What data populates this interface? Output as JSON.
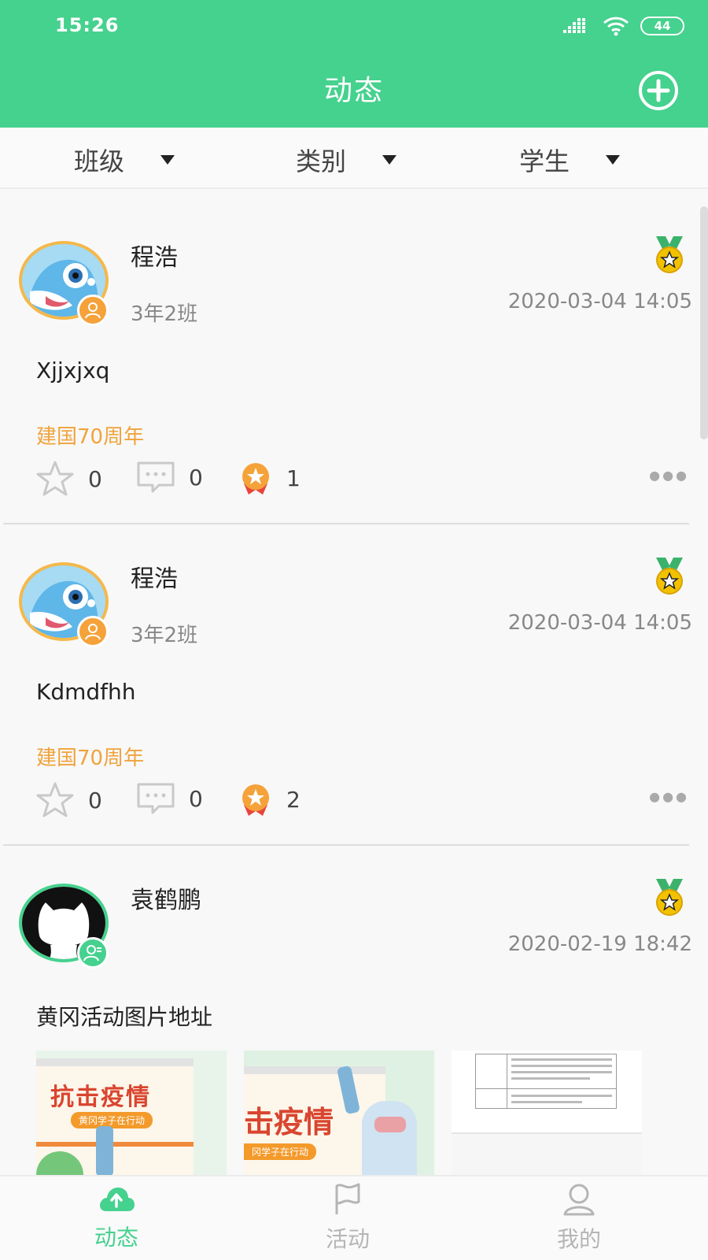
{
  "status_bar": {
    "time": "15:26",
    "battery": "44"
  },
  "header": {
    "title": "动态"
  },
  "filters": [
    {
      "label": "班级"
    },
    {
      "label": "类别"
    },
    {
      "label": "学生"
    }
  ],
  "posts": [
    {
      "author": "程浩",
      "class": "3年2班",
      "date": "2020-03-04 14:05",
      "content": "Xjjxjxq",
      "topic": "建国70周年",
      "likes": "0",
      "comments": "0",
      "awards": "1",
      "avatar": "dolphin"
    },
    {
      "author": "程浩",
      "class": "3年2班",
      "date": "2020-03-04 14:05",
      "content": "Kdmdfhh",
      "topic": "建国70周年",
      "likes": "0",
      "comments": "0",
      "awards": "2",
      "avatar": "dolphin"
    },
    {
      "author": "袁鹤鹏",
      "class": "",
      "date": "2020-02-19 18:42",
      "content": "黄冈活动图片地址",
      "images": [
        {
          "title": "抗击疫情",
          "subtitle": "黄冈学子在行动"
        },
        {
          "title": "击疫情",
          "subtitle": "冈学子在行动"
        },
        {
          "title": ""
        }
      ],
      "avatar": "cat"
    }
  ],
  "tabbar": [
    {
      "label": "动态",
      "icon": "cloud-upload-icon",
      "active": true
    },
    {
      "label": "活动",
      "icon": "flag-icon",
      "active": false
    },
    {
      "label": "我的",
      "icon": "user-icon",
      "active": false
    }
  ],
  "colors": {
    "primary": "#45d18e",
    "topic": "#f0a33c",
    "avatar_badge": "#f5a23a"
  }
}
